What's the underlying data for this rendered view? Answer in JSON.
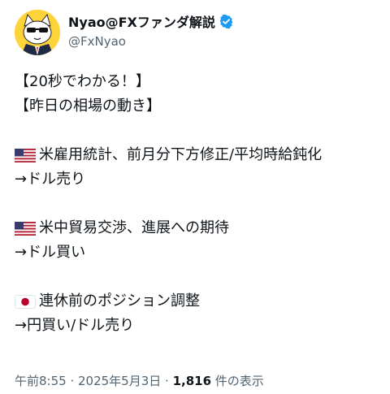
{
  "profile": {
    "display_name": "Nyao@FXファンダ解説",
    "handle": "@FxNyao",
    "avatar_icon": "cat-avatar-icon",
    "verified_icon": "verified-badge-icon",
    "accent_color": "#1d9bf0"
  },
  "tweet": {
    "lines": [
      {
        "text": "【20秒でわかる！】"
      },
      {
        "text": "【昨日の相場の動き】"
      },
      {
        "text": ""
      },
      {
        "flag": "us-flag-icon",
        "text": "米雇用統計、前月分下方修正/平均時給鈍化"
      },
      {
        "text": "→ドル売り"
      },
      {
        "text": ""
      },
      {
        "flag": "us-flag-icon",
        "text": "米中貿易交渉、進展への期待"
      },
      {
        "text": "→ドル買い"
      },
      {
        "text": ""
      },
      {
        "flag": "jp-flag-icon",
        "text": "連休前のポジション調整"
      },
      {
        "text": "→円買い/ドル売り"
      }
    ]
  },
  "meta": {
    "time": "午前8:55",
    "separator": " · ",
    "date": "2025年5月3日",
    "views_count": "1,816",
    "views_label": " 件の表示"
  }
}
